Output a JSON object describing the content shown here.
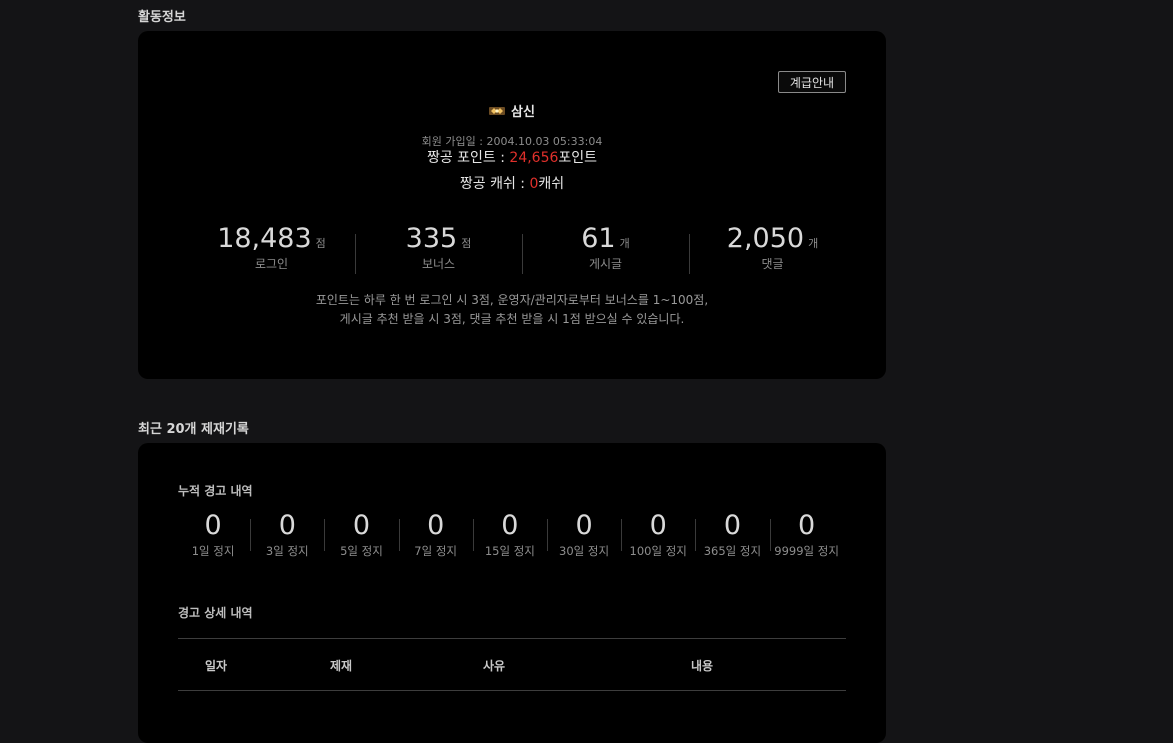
{
  "activity": {
    "section_title": "활동정보",
    "rank_name": "삼신",
    "grade_button": "계급안내",
    "join_label": "회원 가입일 : ",
    "join_date": "2004.10.03 05:33:04",
    "point": {
      "prefix": "짱공 포인트 : ",
      "value": "24,656",
      "suffix": "포인트"
    },
    "cash": {
      "prefix": "짱공 캐쉬 : ",
      "value": "0",
      "suffix": "캐쉬"
    },
    "stats": [
      {
        "value": "18,483",
        "unit": "점",
        "label": "로그인"
      },
      {
        "value": "335",
        "unit": "점",
        "label": "보너스"
      },
      {
        "value": "61",
        "unit": "개",
        "label": "게시글"
      },
      {
        "value": "2,050",
        "unit": "개",
        "label": "댓글"
      }
    ],
    "desc_line1": "포인트는 하루 한 번  로그인 시 3점, 운영자/관리자로부터  보너스를 1~100점,",
    "desc_line2": "게시글 추천 받을 시 3점, 댓글 추천 받을 시 1점 받으실 수 있습니다."
  },
  "penalty": {
    "section_title": "최근 20개 제재기록",
    "cumulative_title": "누적 경고 내역",
    "warnings": [
      {
        "value": "0",
        "label": "1일 정지"
      },
      {
        "value": "0",
        "label": "3일 정지"
      },
      {
        "value": "0",
        "label": "5일 정지"
      },
      {
        "value": "0",
        "label": "7일 정지"
      },
      {
        "value": "0",
        "label": "15일 정지"
      },
      {
        "value": "0",
        "label": "30일 정지"
      },
      {
        "value": "0",
        "label": "100일 정지"
      },
      {
        "value": "0",
        "label": "365일 정지"
      },
      {
        "value": "0",
        "label": "9999일 정지"
      }
    ],
    "detail_title": "경고 상세 내역",
    "columns": [
      "일자",
      "제재",
      "사유",
      "내용"
    ]
  },
  "colors": {
    "accent_red": "#e0302b",
    "card_bg": "#000000",
    "page_bg": "#141416"
  },
  "icons": {
    "rank": "rank-badge-icon"
  }
}
